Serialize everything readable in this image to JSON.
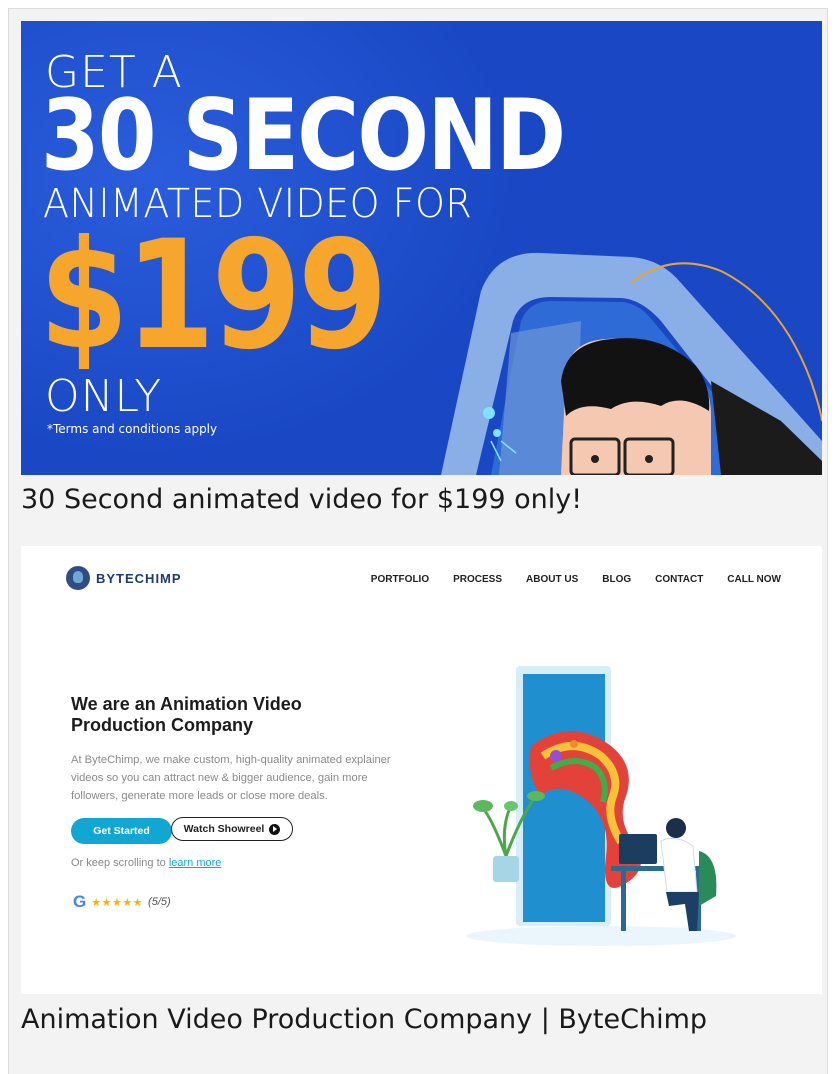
{
  "banner": {
    "line1": "GET A",
    "line2": "30 SECOND",
    "line3": "ANIMATED VIDEO FOR",
    "price": "$199",
    "line5": "ONLY",
    "terms": "*Terms and conditions apply",
    "colors": {
      "background": "#1a48c4",
      "price": "#f6a62d"
    }
  },
  "results": [
    {
      "title": "30 Second animated video for $199 only!"
    },
    {
      "title": "Animation Video Production Company | ByteChimp"
    }
  ],
  "site": {
    "logo": {
      "text": "BYTECHIMP",
      "icon": "chimp-logo-icon"
    },
    "nav": [
      "PORTFOLIO",
      "PROCESS",
      "ABOUT US",
      "BLOG",
      "CONTACT",
      "CALL NOW"
    ],
    "hero": {
      "title": "We are an Animation Video Production Company",
      "description": "At ByteChimp, we make custom, high-quality animated explainer videos so you can attract new & bigger audience, gain more followers, generate more leads or close more deals.",
      "cta_primary": "Get Started",
      "cta_secondary": "Watch Showreel",
      "scroll_prefix": "Or keep scrolling to ",
      "scroll_link": "learn more",
      "rating_stars": "★★★★★",
      "rating_score": "(5/5)",
      "rating_icon": "google-icon"
    },
    "colors": {
      "accent": "#11a7d2",
      "brand": "#1f3b6b"
    }
  }
}
